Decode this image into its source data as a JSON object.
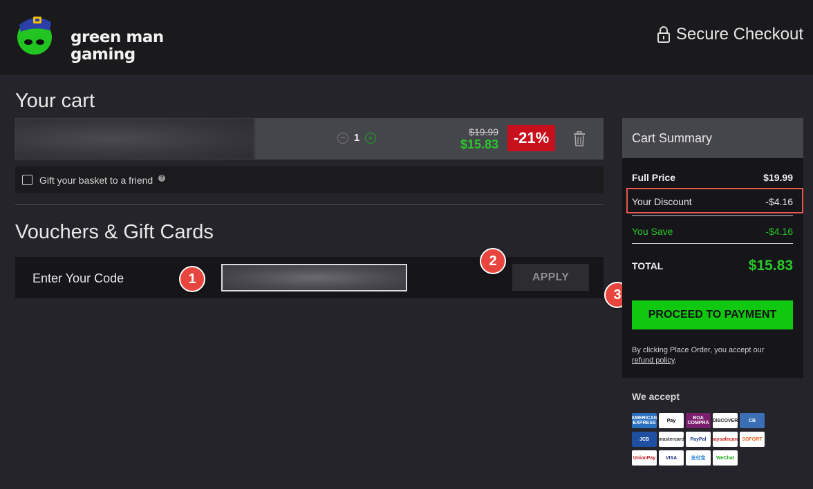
{
  "header": {
    "brand_line1": "green man",
    "brand_line2": "gaming",
    "secure_label": "Secure Checkout"
  },
  "cart": {
    "title": "Your cart",
    "item": {
      "quantity": "1",
      "original_price": "$19.99",
      "sale_price": "$15.83",
      "discount": "-21%"
    },
    "gift_label": "Gift your basket to a friend",
    "help_glyph": "?"
  },
  "vouchers": {
    "title": "Vouchers & Gift Cards",
    "label": "Enter Your Code",
    "apply_label": "APPLY"
  },
  "summary": {
    "title": "Cart Summary",
    "full_price_label": "Full Price",
    "full_price_value": "$19.99",
    "discount_label": "Your Discount",
    "discount_value": "-$4.16",
    "save_label": "You Save",
    "save_value": "-$4.16",
    "total_label": "TOTAL",
    "total_value": "$15.83",
    "pay_label": "PROCEED TO PAYMENT",
    "legal_text": "By clicking Place Order, you accept our",
    "legal_link": "refund policy",
    "legal_end": "."
  },
  "accept": {
    "title": "We accept",
    "cards": [
      {
        "name": "AMERICAN EXPRESS",
        "bg": "#2a6fc0",
        "fg": "#ffffff"
      },
      {
        "name": "Pay",
        "bg": "#ffffff",
        "fg": "#000000"
      },
      {
        "name": "BOA COMPRA",
        "bg": "#7a1e6e",
        "fg": "#ffffff"
      },
      {
        "name": "DISCOVER",
        "bg": "#ffffff",
        "fg": "#222222"
      },
      {
        "name": "CB",
        "bg": "#3a6fb5",
        "fg": "#ffffff"
      },
      {
        "name": "",
        "bg": "transparent",
        "fg": "#ffffff"
      },
      {
        "name": "JCB",
        "bg": "#1e4fa0",
        "fg": "#ffffff"
      },
      {
        "name": "mastercard",
        "bg": "#ffffff",
        "fg": "#333333"
      },
      {
        "name": "PayPal",
        "bg": "#ffffff",
        "fg": "#1e3f8f"
      },
      {
        "name": "paysafecard",
        "bg": "#ffffff",
        "fg": "#cc2222"
      },
      {
        "name": "SOFORT",
        "bg": "#ffffff",
        "fg": "#e86420"
      },
      {
        "name": "",
        "bg": "transparent",
        "fg": "#ffffff"
      },
      {
        "name": "UnionPay",
        "bg": "#ffffff",
        "fg": "#c01a1a"
      },
      {
        "name": "VISA",
        "bg": "#ffffff",
        "fg": "#1a2a80"
      },
      {
        "name": "支付宝",
        "bg": "#ffffff",
        "fg": "#1a7ad0"
      },
      {
        "name": "WeChat",
        "bg": "#ffffff",
        "fg": "#1aaa1a"
      }
    ]
  },
  "annotations": {
    "step1": "1",
    "step2": "2",
    "step3": "3"
  },
  "colors": {
    "accent_green": "#10c810",
    "price_green": "#28c828",
    "discount_red": "#c8101c",
    "marker_red": "#e8453e"
  }
}
